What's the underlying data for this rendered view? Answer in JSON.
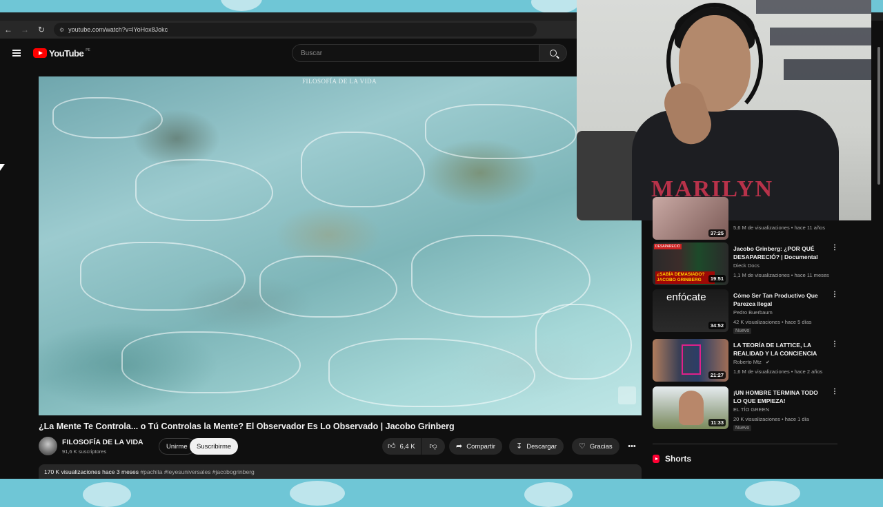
{
  "browser": {
    "url": "youtube.com/watch?v=lYoHox8Jokc"
  },
  "header": {
    "logo_text": "YouTube",
    "logo_country": "PE",
    "search_placeholder": "Buscar"
  },
  "player": {
    "watermark": "FILOSOFÍA DE LA VIDA"
  },
  "video": {
    "title": "¿La Mente Te Controla... o Tú Controlas la Mente? El Observador Es Lo Observado | Jacobo Grinberg",
    "channel_name": "FILOSOFÍA DE LA VIDA",
    "subscribers": "91,6 K suscriptores",
    "join_label": "Unirme",
    "subscribe_label": "Suscribirme",
    "likes": "6,4 K",
    "share_label": "Compartir",
    "download_label": "Descargar",
    "thanks_label": "Gracias",
    "description_stats": "170 K visualizaciones  hace 3 meses",
    "description_tags": " #pachita #leyesuniversales #jacobogrinberg"
  },
  "webcam": {
    "shirt_text": "MARILYN"
  },
  "sidebar": {
    "partial_item": {
      "duration": "37:25",
      "meta": "5,6 M de visualizaciones • hace 11 años"
    },
    "items": [
      {
        "title": "Jacobo Grinberg: ¿POR QUÉ DESAPARECIÓ? | Documental",
        "channel": "Dieck Docs",
        "meta": "1,1 M de visualizaciones • hace 11 meses",
        "duration": "19:51",
        "badge": "",
        "thumb_text": "¿SABÍA DEMASIADO? JACOBO GRINBERG",
        "thumb_corner": "DESAPARECIÓ"
      },
      {
        "title": "Cómo Ser Tan Productivo Que Parezca Ilegal",
        "channel": "Pedro Buerbaum",
        "meta": "42 K visualizaciones • hace 5 días",
        "duration": "34:52",
        "badge": "Nuevo",
        "thumb_text": "enfócate",
        "thumb_corner": ""
      },
      {
        "title": "LA TEORÍA DE LATTICE, LA REALIDAD Y LA CONCIENCIA",
        "channel": "Roberto Mtz",
        "meta": "1,6 M de visualizaciones • hace 2 años",
        "duration": "21:27",
        "badge": "",
        "thumb_text": "",
        "thumb_corner": ""
      },
      {
        "title": "¡UN HOMBRE TERMINA TODO LO QUE EMPIEZA!",
        "channel": "EL TÍO GREEN",
        "meta": "20 K visualizaciones • hace 1 día",
        "duration": "11:33",
        "badge": "Nuevo",
        "thumb_text": "",
        "thumb_corner": ""
      }
    ],
    "shorts_label": "Shorts"
  },
  "colors": {
    "accent_red": "#ff0000",
    "background": "#0f0f0f",
    "desktop": "#6fc6d6"
  }
}
